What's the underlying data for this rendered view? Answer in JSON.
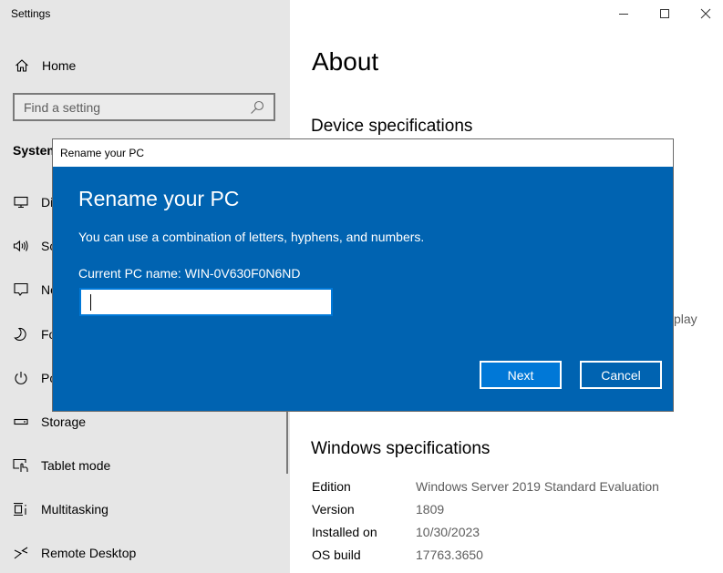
{
  "app": {
    "title": "Settings"
  },
  "sidebar": {
    "home_label": "Home",
    "search": {
      "placeholder": "Find a setting",
      "value": ""
    },
    "section_title": "System",
    "items": [
      {
        "label": "Display",
        "icon": "monitor-icon"
      },
      {
        "label": "Sound",
        "icon": "speaker-icon"
      },
      {
        "label": "Notifications & actions",
        "icon": "notification-icon"
      },
      {
        "label": "Focus assist",
        "icon": "moon-icon"
      },
      {
        "label": "Power & sleep",
        "icon": "power-icon"
      },
      {
        "label": "Storage",
        "icon": "storage-icon"
      },
      {
        "label": "Tablet mode",
        "icon": "tablet-mode-icon"
      },
      {
        "label": "Multitasking",
        "icon": "multitasking-icon"
      },
      {
        "label": "Remote Desktop",
        "icon": "remote-desktop-icon"
      }
    ]
  },
  "window_controls": {
    "minimize": "—",
    "maximize": "☐",
    "close": "✕"
  },
  "main": {
    "page_title": "About",
    "device_specs_title": "Device specifications",
    "peek_text": "play",
    "windows_specs_title": "Windows specifications",
    "windows_specs": [
      {
        "key": "Edition",
        "value": "Windows Server 2019 Standard Evaluation"
      },
      {
        "key": "Version",
        "value": "1809"
      },
      {
        "key": "Installed on",
        "value": "10/30/2023"
      },
      {
        "key": "OS build",
        "value": "17763.3650"
      }
    ]
  },
  "dialog": {
    "window_title": "Rename your PC",
    "heading": "Rename your PC",
    "description": "You can use a combination of letters, hyphens, and numbers.",
    "current_name_label": "Current PC name: WIN-0V630F0N6ND",
    "input_value": "",
    "next_label": "Next",
    "cancel_label": "Cancel",
    "colors": {
      "background": "#0063b1",
      "primary_button": "#0078d7"
    }
  }
}
